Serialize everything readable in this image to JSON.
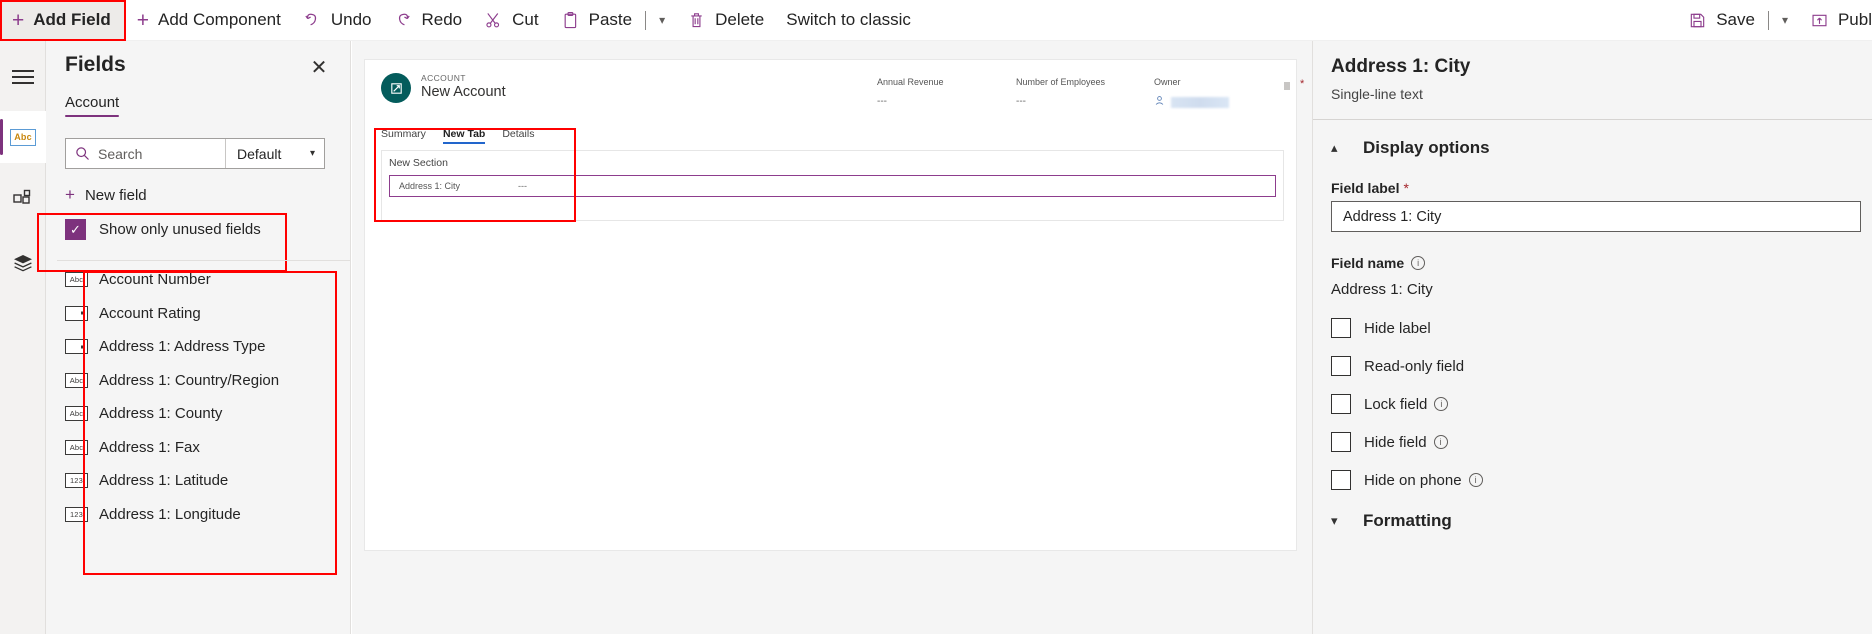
{
  "commandbar": {
    "items": [
      {
        "label": "Add Field",
        "icon": "plus-icon",
        "highlighted": true
      },
      {
        "label": "Add Component",
        "icon": "plus-icon"
      },
      {
        "label": "Undo",
        "icon": "undo-arrow-icon"
      },
      {
        "label": "Redo",
        "icon": "redo-arrow-icon"
      },
      {
        "label": "Cut",
        "icon": "scissors-icon"
      },
      {
        "label": "Paste",
        "icon": "clipboard-icon"
      },
      {
        "label": "Delete",
        "icon": "trash-icon"
      },
      {
        "label": "Switch to classic",
        "icon": ""
      }
    ],
    "right_items": [
      {
        "label": "Save",
        "icon": "floppy-disk-icon"
      },
      {
        "label": "Publ",
        "icon": "publish-icon"
      }
    ]
  },
  "rail": {
    "items": [
      {
        "name": "menu",
        "icon": "hamburger-icon",
        "active": false
      },
      {
        "name": "fields",
        "icon": "abc-text-icon",
        "active": true
      },
      {
        "name": "components",
        "icon": "components-grid-icon",
        "active": false
      },
      {
        "name": "layers",
        "icon": "layers-stack-icon",
        "active": false
      }
    ]
  },
  "fields_panel": {
    "title": "Fields",
    "close_icon": "close-icon",
    "tab": "Account",
    "search_placeholder": "Search",
    "search_value": "",
    "filter_selected": "Default",
    "new_field_label": "New field",
    "show_unused_label": "Show only unused fields",
    "show_unused_checked": true,
    "items": [
      {
        "label": "Account Number",
        "type": "Abc"
      },
      {
        "label": "Account Rating",
        "type": "option"
      },
      {
        "label": "Address 1: Address Type",
        "type": "option"
      },
      {
        "label": "Address 1: Country/Region",
        "type": "Abc"
      },
      {
        "label": "Address 1: County",
        "type": "Abc"
      },
      {
        "label": "Address 1: Fax",
        "type": "Abc"
      },
      {
        "label": "Address 1: Latitude",
        "type": "123"
      },
      {
        "label": "Address 1: Longitude",
        "type": "123"
      }
    ]
  },
  "canvas": {
    "entity_label": "ACCOUNT",
    "record_name": "New Account",
    "header_fields": [
      {
        "label": "Annual Revenue",
        "value": "---"
      },
      {
        "label": "Number of Employees",
        "value": "---"
      },
      {
        "label": "Owner",
        "value": "",
        "required": true,
        "redacted": true
      }
    ],
    "tabs": [
      {
        "label": "Summary",
        "active": false
      },
      {
        "label": "New Tab",
        "active": true
      },
      {
        "label": "Details",
        "active": false
      }
    ],
    "section_title": "New Section",
    "field_row": {
      "label": "Address 1: City",
      "value": "---"
    }
  },
  "properties": {
    "title": "Address 1: City",
    "subtitle": "Single-line text",
    "display_options": {
      "title": "Display options",
      "expanded": true,
      "field_label_caption": "Field label",
      "field_label_required": "*",
      "field_label_value": "Address 1: City",
      "field_name_caption": "Field name",
      "field_name_value": "Address 1: City",
      "checkboxes": [
        {
          "label": "Hide label",
          "checked": false,
          "info": false
        },
        {
          "label": "Read-only field",
          "checked": false,
          "info": false
        },
        {
          "label": "Lock field",
          "checked": false,
          "info": true
        },
        {
          "label": "Hide field",
          "checked": false,
          "info": true
        },
        {
          "label": "Hide on phone",
          "checked": false,
          "info": true
        }
      ]
    },
    "formatting": {
      "title": "Formatting",
      "expanded": false
    }
  },
  "colors": {
    "accent_purple": "#7d327d",
    "highlight_red": "#ff0000",
    "required_red": "#a4262c",
    "tab_blue": "#2266cc",
    "avatar_teal": "#045c5c"
  }
}
